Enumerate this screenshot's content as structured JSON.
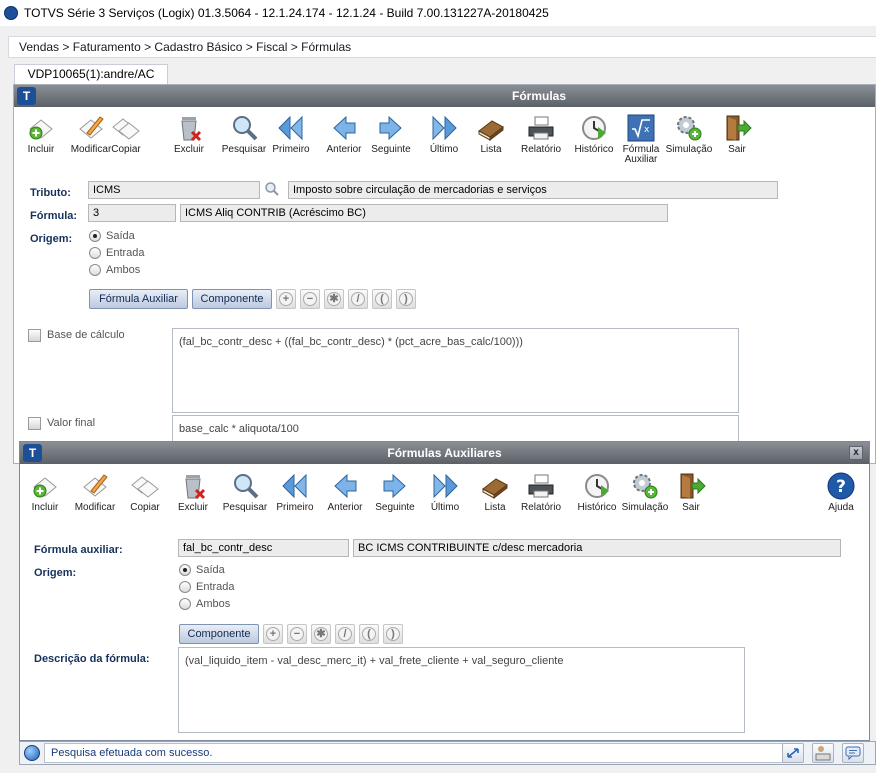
{
  "app": {
    "title": "TOTVS Série 3 Serviços (Logix) 01.3.5064   -   12.1.24.174 - 12.1.24 - Build 7.00.131227A-20180425"
  },
  "breadcrumb": "Vendas > Faturamento > Cadastro Básico > Fiscal > Fórmulas",
  "tab": {
    "label": "VDP10065(1):andre/AC"
  },
  "main": {
    "title": "Fórmulas",
    "toolbar": [
      {
        "label": "Incluir",
        "icon": "add-icon"
      },
      {
        "label": "Modificar",
        "icon": "edit-icon"
      },
      {
        "label": "Copiar",
        "icon": "copy-icon"
      },
      {
        "label": "Excluir",
        "icon": "trash-icon"
      },
      {
        "label": "Pesquisar",
        "icon": "search-icon"
      },
      {
        "label": "Primeiro",
        "icon": "first-icon"
      },
      {
        "label": "Anterior",
        "icon": "previous-icon"
      },
      {
        "label": "Seguinte",
        "icon": "next-icon"
      },
      {
        "label": "Último",
        "icon": "last-icon"
      },
      {
        "label": "Lista",
        "icon": "book-icon"
      },
      {
        "label": "Relatório",
        "icon": "printer-icon"
      },
      {
        "label": "Histórico",
        "icon": "history-icon"
      },
      {
        "label": "Fórmula\nAuxiliar",
        "icon": "formula-icon"
      },
      {
        "label": "Simulação",
        "icon": "gears-icon"
      },
      {
        "label": "Sair",
        "icon": "exit-icon"
      }
    ],
    "tributo": {
      "label": "Tributo:",
      "code": "ICMS",
      "desc": "Imposto sobre circulação de mercadorias e serviços"
    },
    "formula": {
      "label": "Fórmula:",
      "code": "3",
      "desc": "ICMS Aliq CONTRIB (Acréscimo BC)"
    },
    "origem": {
      "label": "Origem:",
      "options": [
        "Saída",
        "Entrada",
        "Ambos"
      ],
      "selected": "Saída"
    },
    "buttons": {
      "aux": "Fórmula Auxiliar",
      "component": "Componente"
    },
    "operators": [
      "+",
      "−",
      "✱",
      "/",
      "(",
      ")"
    ],
    "base_calculo": {
      "label": "Base de cálculo",
      "expr": "(fal_bc_contr_desc + ((fal_bc_contr_desc) * (pct_acre_bas_calc/100)))"
    },
    "valor_final": {
      "label": "Valor final",
      "expr": "base_calc * aliquota/100"
    }
  },
  "aux": {
    "title": "Fórmulas Auxiliares",
    "close": "x",
    "toolbar": [
      {
        "label": "Incluir",
        "icon": "add-icon"
      },
      {
        "label": "Modificar",
        "icon": "edit-icon"
      },
      {
        "label": "Copiar",
        "icon": "copy-icon"
      },
      {
        "label": "Excluir",
        "icon": "trash-icon"
      },
      {
        "label": "Pesquisar",
        "icon": "search-icon"
      },
      {
        "label": "Primeiro",
        "icon": "first-icon"
      },
      {
        "label": "Anterior",
        "icon": "previous-icon"
      },
      {
        "label": "Seguinte",
        "icon": "next-icon"
      },
      {
        "label": "Último",
        "icon": "last-icon"
      },
      {
        "label": "Lista",
        "icon": "book-icon"
      },
      {
        "label": "Relatório",
        "icon": "printer-icon"
      },
      {
        "label": "Histórico",
        "icon": "history-icon"
      },
      {
        "label": "Simulação",
        "icon": "gears-icon"
      },
      {
        "label": "Sair",
        "icon": "exit-icon"
      },
      {
        "label": "Ajuda",
        "icon": "help-icon"
      }
    ],
    "formula_aux": {
      "label": "Fórmula auxiliar:",
      "code": "fal_bc_contr_desc",
      "desc": "BC ICMS CONTRIBUINTE c/desc mercadoria"
    },
    "origem": {
      "label": "Origem:",
      "options": [
        "Saída",
        "Entrada",
        "Ambos"
      ],
      "selected": "Saída"
    },
    "component": "Componente",
    "descricao": {
      "label": "Descrição da fórmula:",
      "expr": "(val_liquido_item - val_desc_merc_it) + val_frete_cliente + val_seguro_cliente"
    }
  },
  "status": {
    "message": "Pesquisa efetuada com sucesso."
  }
}
